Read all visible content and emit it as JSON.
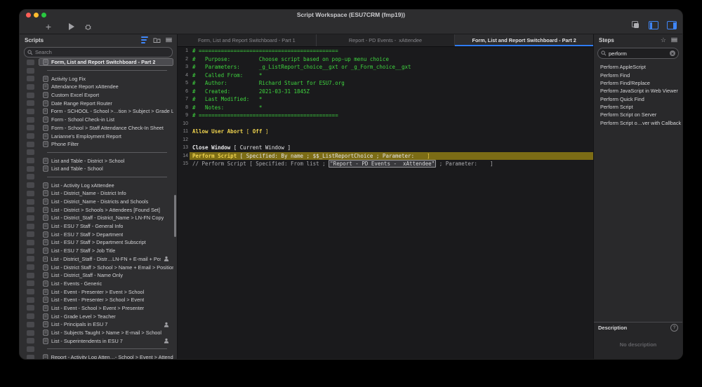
{
  "window": {
    "title": "Script Workspace (ESU7CRM (fmp19))"
  },
  "icons": {
    "plus": "+",
    "star": "☆",
    "help": "?"
  },
  "colors": {
    "accent_blue": "#2f7cf7",
    "code_green": "#3fd53f",
    "code_yellow": "#e9cb4a",
    "highlight_row": "#7c6c15",
    "traffic_close": "#ff5f57",
    "traffic_minimize": "#febc2e",
    "traffic_zoom": "#28c840"
  },
  "scripts_panel": {
    "title": "Scripts",
    "search_placeholder": "Search",
    "items": [
      {
        "type": "script",
        "label": "Form, List and Report Switchboard - Part 2",
        "selected": true
      },
      {
        "type": "divider"
      },
      {
        "type": "script",
        "label": "Activity Log Fix"
      },
      {
        "type": "script",
        "label": "Attendance Report xAttendee"
      },
      {
        "type": "script",
        "label": "Custom Excel Export"
      },
      {
        "type": "script",
        "label": "Date Range Report Router"
      },
      {
        "type": "script",
        "label": "Form - SCHOOL - School >…tion > Subject > Grade Level"
      },
      {
        "type": "script",
        "label": "Form - School Check-in List"
      },
      {
        "type": "script",
        "label": "Form - School > Staff Attendance Check-In Sheet"
      },
      {
        "type": "script",
        "label": "Larianne's Employment Report"
      },
      {
        "type": "script",
        "label": "Phone Filter"
      },
      {
        "type": "divider"
      },
      {
        "type": "script",
        "label": "List and Table - District > School"
      },
      {
        "type": "script",
        "label": "List and Table - School"
      },
      {
        "type": "divider"
      },
      {
        "type": "script",
        "label": "List - Activity Log xAttendee"
      },
      {
        "type": "script",
        "label": "List - District_Name - District Info"
      },
      {
        "type": "script",
        "label": "List - District_Name - Districts and Schools"
      },
      {
        "type": "script",
        "label": "List - District > Schools > Attendees [Found Set]"
      },
      {
        "type": "script",
        "label": "List - District_Staff - District_Name > LN-FN Copy"
      },
      {
        "type": "script",
        "label": "List - ESU 7 Staff - General Info"
      },
      {
        "type": "script",
        "label": "List - ESU 7 Staff > Department"
      },
      {
        "type": "script",
        "label": "List - ESU 7 Staff > Department Subscript"
      },
      {
        "type": "script",
        "label": "List - ESU 7 Staff > Job Title"
      },
      {
        "type": "script",
        "label": "List - District_Staff - Distr…LN-FN + E-mail + Position",
        "badge": "person"
      },
      {
        "type": "script",
        "label": "List - District Staff > School > Name + Email > Position"
      },
      {
        "type": "script",
        "label": "List - District_Staff - Name Only"
      },
      {
        "type": "script",
        "label": "List - Events - Generic"
      },
      {
        "type": "script",
        "label": "List - Event - Presenter > Event > School"
      },
      {
        "type": "script",
        "label": "List - Event - Presenter > School > Event"
      },
      {
        "type": "script",
        "label": "List - Event - School > Event > Presenter"
      },
      {
        "type": "script",
        "label": "List - Grade Level > Teacher"
      },
      {
        "type": "script",
        "label": "List - Principals in ESU 7",
        "badge": "person"
      },
      {
        "type": "script",
        "label": "List - Subjects Taught > Name > E-mail > School"
      },
      {
        "type": "script",
        "label": "List - Superintendents in ESU 7",
        "badge": "person"
      },
      {
        "type": "divider"
      },
      {
        "type": "script",
        "label": "Report - Activity Log Atten…- School > Event > Attendee"
      }
    ]
  },
  "tabs": [
    {
      "label": "Form, List and Report Switchboard - Part 1",
      "active": false
    },
    {
      "label": "Report - PD Events -  xAttendee",
      "active": false
    },
    {
      "label": "Form, List and Report Switchboard - Part 2",
      "active": true
    }
  ],
  "editor": {
    "lines": [
      {
        "num": 1,
        "parts": [
          [
            "# ============================================",
            "c"
          ]
        ]
      },
      {
        "num": 2,
        "parts": [
          [
            "#   Purpose:         Choose script based on pop-up menu choice",
            "c"
          ]
        ]
      },
      {
        "num": 3,
        "parts": [
          [
            "#   Parameters:      _g_ListReport_choice__gxt or _g_Form_choice__gxt",
            "c"
          ]
        ]
      },
      {
        "num": 4,
        "parts": [
          [
            "#   Called From:     *",
            "c"
          ]
        ]
      },
      {
        "num": 5,
        "parts": [
          [
            "#   Author:          Richard Stuart for ESU7.org",
            "c"
          ]
        ]
      },
      {
        "num": 6,
        "parts": [
          [
            "#   Created:         2021-03-31 1845Z",
            "c"
          ]
        ]
      },
      {
        "num": 7,
        "parts": [
          [
            "#   Last Modified:   *",
            "c"
          ]
        ]
      },
      {
        "num": 8,
        "parts": [
          [
            "#   Notes:           *",
            "c"
          ]
        ]
      },
      {
        "num": 9,
        "parts": [
          [
            "# ============================================",
            "c"
          ]
        ]
      },
      {
        "num": 10,
        "parts": []
      },
      {
        "num": 11,
        "parts": [
          [
            "Allow User Abort",
            "yb"
          ],
          [
            " [ ",
            "y"
          ],
          [
            "Off",
            "yb"
          ],
          [
            " ]",
            "y"
          ]
        ]
      },
      {
        "num": 12,
        "parts": []
      },
      {
        "num": 13,
        "parts": [
          [
            "Close Window",
            "wb"
          ],
          [
            " [ Current Window ]",
            "w"
          ]
        ]
      },
      {
        "num": 14,
        "hl": true,
        "parts": [
          [
            "Perform Script",
            "yb"
          ],
          [
            " [ Specified: By name ; $$_ListReportChoice ; Parameter:    ",
            "w"
          ],
          [
            "]",
            "y"
          ]
        ]
      },
      {
        "num": 15,
        "parts": [
          [
            "// Perform Script [ Specified: From list ; ",
            "g"
          ],
          [
            "\"Report - PD Events -  xAttendee\"",
            "gq"
          ],
          [
            " ; Parameter:    ]",
            "g"
          ]
        ]
      }
    ]
  },
  "steps_panel": {
    "title": "Steps",
    "search_value": "perform",
    "items": [
      "Perform AppleScript",
      "Perform Find",
      "Perform Find/Replace",
      "Perform JavaScript in Web Viewer",
      "Perform Quick Find",
      "Perform Script",
      "Perform Script on Server",
      "Perform Script o…ver with Callback"
    ]
  },
  "description_panel": {
    "title": "Description",
    "empty_text": "No description"
  }
}
